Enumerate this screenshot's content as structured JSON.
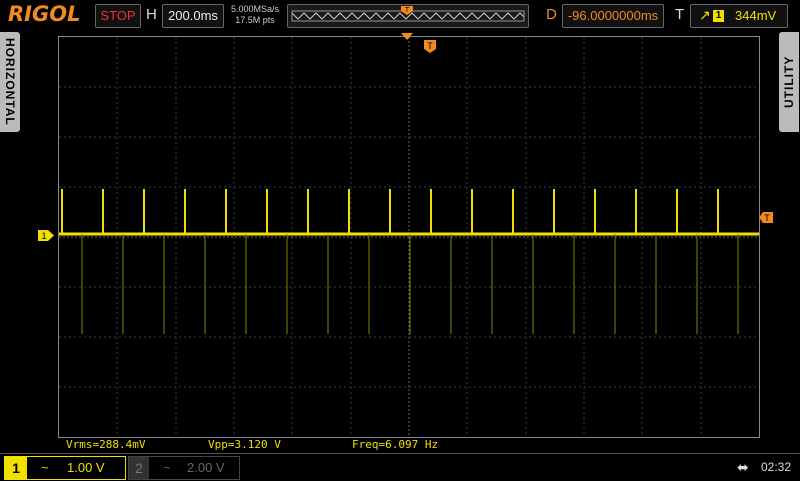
{
  "brand": "RIGOL",
  "run_state": "STOP",
  "horizontal": {
    "label": "H",
    "timebase": "200.0ms",
    "sample_rate": "5.000MSa/s",
    "memory_depth": "17.5M pts"
  },
  "delay": {
    "label": "D",
    "value": "-96.0000000ms"
  },
  "trigger": {
    "label": "T",
    "edge_icon": "rising-edge-icon",
    "channel": "1",
    "level": "344mV"
  },
  "side_tabs": {
    "left": "HORIZONTAL",
    "right": "UTILITY"
  },
  "markers": {
    "trigger_pos": "T",
    "trigger_level": "T",
    "channel1": "1"
  },
  "measurements": {
    "vrms": "Vrms=288.4mV",
    "vpp": "Vpp=3.120 V",
    "freq": "Freq=6.097 Hz"
  },
  "channels": [
    {
      "num": "1",
      "coupling": "~",
      "scale": "1.00 V",
      "active": true
    },
    {
      "num": "2",
      "coupling": "~",
      "scale": "2.00 V",
      "active": false
    }
  ],
  "status": {
    "usb_icon": "usb-icon",
    "time": "02:32"
  },
  "colors": {
    "ch1": "#f0e000",
    "brand": "#f28a1e",
    "stop": "#e33333",
    "marker": "#f28a1e"
  }
}
